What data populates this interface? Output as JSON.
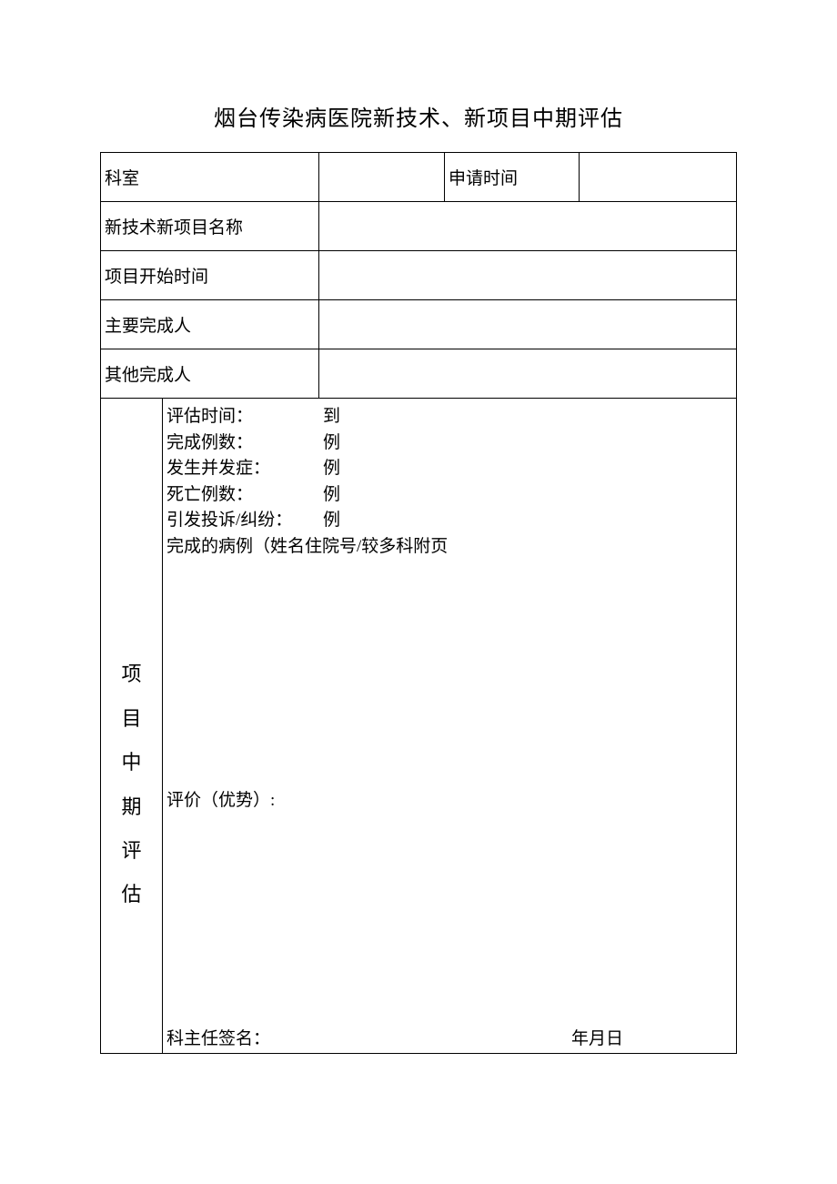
{
  "title": "烟台传染病医院新技术、新项目中期评估",
  "header": {
    "dept_label": "科室",
    "apply_time_label": "申请时间",
    "project_name_label": "新技术新项目名称",
    "start_time_label": "项目开始时间",
    "main_person_label": "主要完成人",
    "other_person_label": "其他完成人"
  },
  "midterm": {
    "section_chars": [
      "项",
      "目",
      "中",
      "期",
      "评",
      "估"
    ],
    "eval_time_label": "评估时间：",
    "eval_time_val": "到",
    "cases_done_label": "完成例数：",
    "cases_done_val": "例",
    "complication_label": "发生并发症：",
    "complication_val": "例",
    "death_label": "死亡例数：",
    "death_val": "例",
    "complaint_label": "引发投诉/纠纷：",
    "complaint_val": "例",
    "cases_detail_label": "完成的病例（姓名住院号/较多科附页",
    "evaluation_label": "评价（优势）:",
    "sign_label": "科主任签名：",
    "sign_date": "年月日"
  }
}
